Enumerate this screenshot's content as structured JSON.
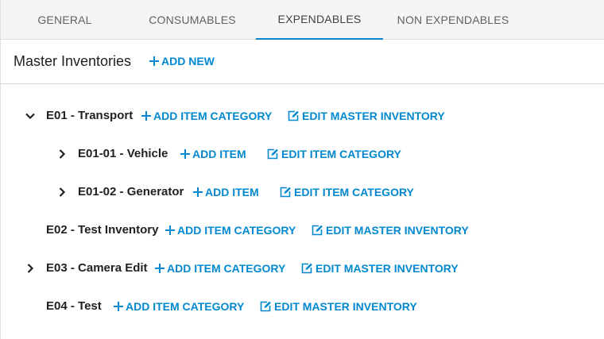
{
  "tabs": [
    {
      "label": "GENERAL"
    },
    {
      "label": "CONSUMABLES"
    },
    {
      "label": "EXPENDABLES"
    },
    {
      "label": "NON EXPENDABLES"
    }
  ],
  "active_tab": "EXPENDABLES",
  "header": {
    "title": "Master Inventories",
    "add_new": "ADD NEW"
  },
  "tree": [
    {
      "name": "E01 - Transport",
      "expanded": true,
      "add": "ADD ITEM CATEGORY",
      "edit": "EDIT MASTER INVENTORY"
    },
    {
      "name": "E01-01 - Vehicle",
      "expanded": false,
      "add": "ADD ITEM",
      "edit": "EDIT ITEM CATEGORY"
    },
    {
      "name": "E01-02 - Generator",
      "expanded": false,
      "add": "ADD ITEM",
      "edit": "EDIT ITEM CATEGORY"
    },
    {
      "name": "E02 - Test Inventory",
      "add": "ADD ITEM CATEGORY",
      "edit": "EDIT MASTER INVENTORY"
    },
    {
      "name": "E03 - Camera Edit",
      "expanded": false,
      "add": "ADD ITEM CATEGORY",
      "edit": "EDIT MASTER INVENTORY"
    },
    {
      "name": "E04 - Test",
      "add": "ADD ITEM CATEGORY",
      "edit": "EDIT MASTER INVENTORY"
    }
  ],
  "colors": {
    "accent": "#0288d1",
    "tab_bar": "#f5f5f5",
    "text": "#212121"
  },
  "icons": {
    "add": "plus-icon",
    "edit": "edit-icon",
    "expanded": "chevron-down-icon",
    "collapsed": "chevron-right-icon"
  }
}
